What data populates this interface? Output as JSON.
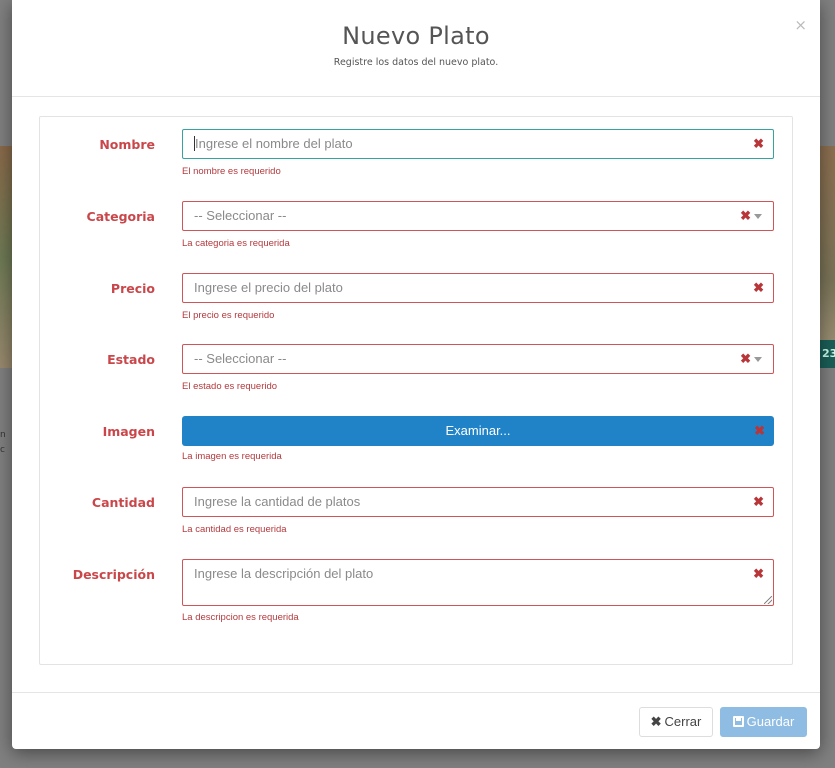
{
  "modal": {
    "title": "Nuevo Plato",
    "subtitle": "Registre los datos del nuevo plato.",
    "close_glyph": "×"
  },
  "form": {
    "nombre": {
      "label": "Nombre",
      "placeholder": "Ingrese el nombre del plato",
      "error": "El nombre es requerido"
    },
    "categoria": {
      "label": "Categoria",
      "selected": "-- Seleccionar --",
      "error": "La categoria es requerida"
    },
    "precio": {
      "label": "Precio",
      "placeholder": "Ingrese el precio del plato",
      "error": "El precio es requerido"
    },
    "estado": {
      "label": "Estado",
      "selected": "-- Seleccionar --",
      "error": "El estado es requerido"
    },
    "imagen": {
      "label": "Imagen",
      "button_label": "Examinar...",
      "error": "La imagen es requerida"
    },
    "cantidad": {
      "label": "Cantidad",
      "placeholder": "Ingrese la cantidad de platos",
      "error": "La cantidad es requerida"
    },
    "descripcion": {
      "label": "Descripción",
      "placeholder": "Ingrese la descripción del plato",
      "error": "La descripcion es requerida"
    },
    "error_icon_glyph": "✖"
  },
  "footer": {
    "close_label": "Cerrar",
    "close_icon": "✖",
    "save_label": "Guardar"
  },
  "background": {
    "badge_text": "23",
    "side_text": "n c"
  },
  "colors": {
    "error": "#c9474b",
    "focus": "#37a3a0",
    "primary": "#2183c7",
    "save_disabled": "#8ebce3"
  }
}
